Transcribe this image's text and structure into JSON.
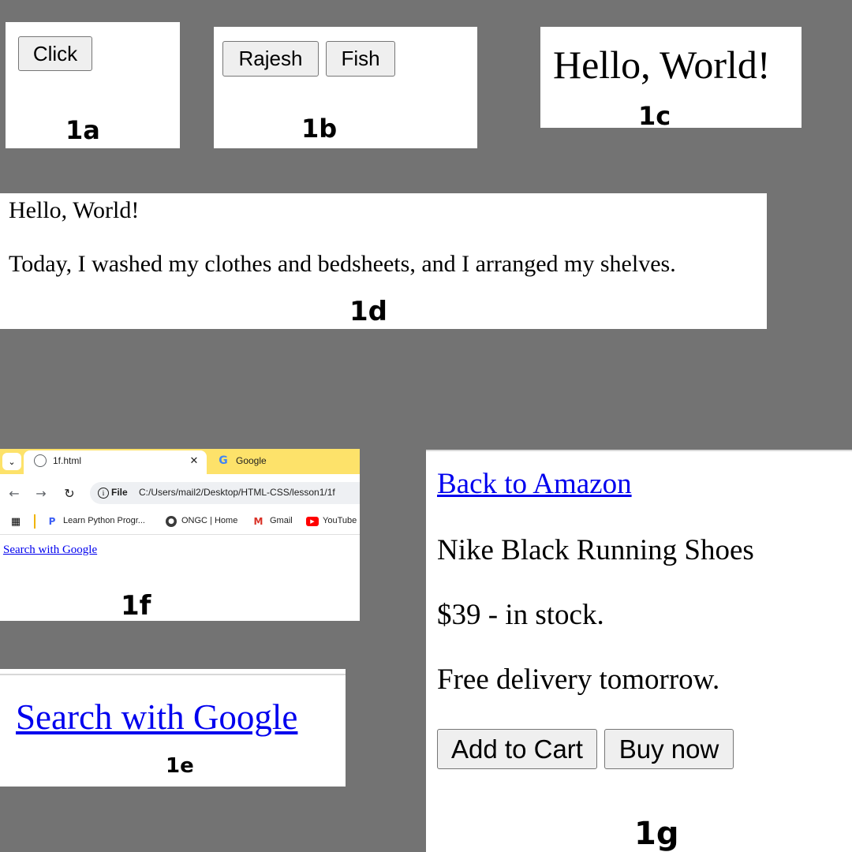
{
  "panels": {
    "p1a": {
      "button_label": "Click",
      "tag": "1a"
    },
    "p1b": {
      "buttons": [
        "Rajesh",
        "Fish"
      ],
      "tag": "1b"
    },
    "p1c": {
      "heading": "Hello, World!",
      "tag": "1c"
    },
    "p1d": {
      "line1": "Hello, World!",
      "line2": "Today, I washed my clothes and bedsheets, and I arranged my shelves.",
      "tag": "1d"
    },
    "p1e": {
      "link": "Search with Google",
      "tag": "1e"
    },
    "p1f": {
      "tabs": [
        "1f.html",
        "Google"
      ],
      "url_scheme": "File",
      "url": "C:/Users/mail2/Desktop/HTML-CSS/lesson1/1f",
      "bookmarks": [
        "Learn Python Progr...",
        "ONGC | Home",
        "Gmail",
        "YouTube"
      ],
      "link": "Search with Google",
      "tag": "1f"
    },
    "p1g": {
      "back_link": "Back to Amazon",
      "product": "Nike Black Running Shoes",
      "price": "$39 - in stock.",
      "delivery": "Free delivery tomorrow.",
      "add_to_cart": "Add to Cart",
      "buy_now": "Buy now",
      "tag": "1g"
    }
  },
  "colors": {
    "background": "#737373",
    "link": "#0000ee",
    "tabbar": "#fde26a"
  },
  "icons": [
    "tab-dropdown-icon",
    "globe-icon",
    "close-icon",
    "google-icon",
    "back-arrow-icon",
    "forward-arrow-icon",
    "reload-icon",
    "info-icon",
    "apps-grid-icon",
    "python-icon",
    "ongc-icon",
    "gmail-icon",
    "youtube-icon"
  ]
}
